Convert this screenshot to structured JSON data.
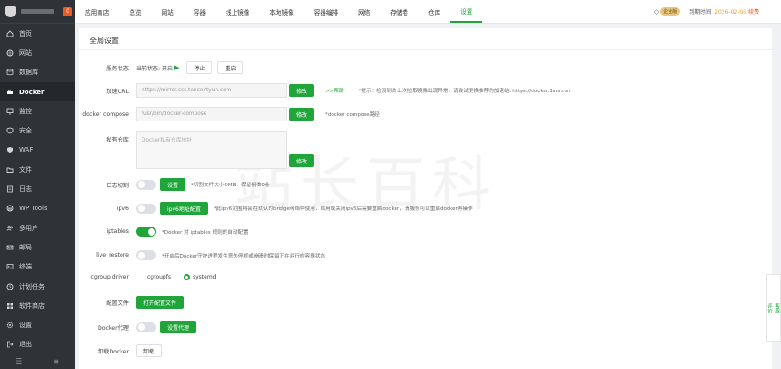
{
  "sidebar": {
    "badge": "0",
    "items": [
      {
        "label": "首页",
        "icon": "home-icon"
      },
      {
        "label": "网站",
        "icon": "globe-icon"
      },
      {
        "label": "数据库",
        "icon": "database-icon"
      },
      {
        "label": "Docker",
        "icon": "docker-icon"
      },
      {
        "label": "监控",
        "icon": "monitor-icon"
      },
      {
        "label": "安全",
        "icon": "shield-icon"
      },
      {
        "label": "WAF",
        "icon": "waf-icon"
      },
      {
        "label": "文件",
        "icon": "folder-icon"
      },
      {
        "label": "日志",
        "icon": "log-icon"
      },
      {
        "label": "WP Tools",
        "icon": "wordpress-icon"
      },
      {
        "label": "多用户",
        "icon": "users-icon"
      },
      {
        "label": "邮局",
        "icon": "mail-icon"
      },
      {
        "label": "终端",
        "icon": "terminal-icon"
      },
      {
        "label": "计划任务",
        "icon": "clock-icon"
      },
      {
        "label": "软件商店",
        "icon": "store-icon"
      },
      {
        "label": "设置",
        "icon": "gear-icon"
      },
      {
        "label": "退出",
        "icon": "logout-icon"
      }
    ],
    "active_index": 3
  },
  "topbar": {
    "tabs": [
      "应用商店",
      "总览",
      "网站",
      "容器",
      "线上镜像",
      "本地镜像",
      "容器编排",
      "网络",
      "存储卷",
      "仓库",
      "设置"
    ],
    "active_tab": 10,
    "pro_label": "企业版",
    "expire_label": "到期时间:",
    "expire_date": "2026-02-06",
    "renew_label": "续费"
  },
  "settings": {
    "title": "全局设置",
    "service_status": {
      "label": "服务状态",
      "current": "当前状态:",
      "state": "开启",
      "stop": "停止",
      "restart": "重启"
    },
    "mirror": {
      "label": "加速URL",
      "value": "https://mirror.ccs.tencentyun.com",
      "modify": "修改",
      "help": ">>帮助",
      "hint": "*提示：检测到尚上次拉取镜像出现异常，请尝试更换推荐的加速站: https://docker.1ms.run"
    },
    "compose": {
      "label": "docker compose",
      "value": "/usr/bin/docker-compose",
      "modify": "修改",
      "hint": "*docker compose路径"
    },
    "registry": {
      "label": "私有仓库",
      "placeholder": "Docker私有仓库地址",
      "modify": "修改"
    },
    "log_cut": {
      "label": "日志切割",
      "setting": "设置",
      "hint": "*切割文件大小OMB，保留份数0份"
    },
    "ipv6": {
      "label": "ipv6",
      "config": "ipv6地址配置",
      "hint": "*此ipv6范围将会在默认的bridge网络中使用，启用或关闭ipv6后需要重启docker，请服务可以重启docker再操作"
    },
    "iptables": {
      "label": "iptables",
      "hint": "*Docker 对 iptables 规则的自动配置"
    },
    "live_restore": {
      "label": "live_restore",
      "hint": "*开启后Docker守护进程发生意外停机或崩溃时保留正在运行的容器状态"
    },
    "cgroup": {
      "label": "cgroup driver",
      "opt1": "cgroupfs",
      "opt2": "systemd"
    },
    "config_file": {
      "label": "配置文件",
      "open": "打开配置文件"
    },
    "proxy": {
      "label": "Docker代理",
      "setting": "设置代理"
    },
    "uninstall": {
      "label": "卸载Docker",
      "button": "卸载"
    }
  },
  "float_panel": {
    "service": "客服",
    "rate": "评价"
  }
}
